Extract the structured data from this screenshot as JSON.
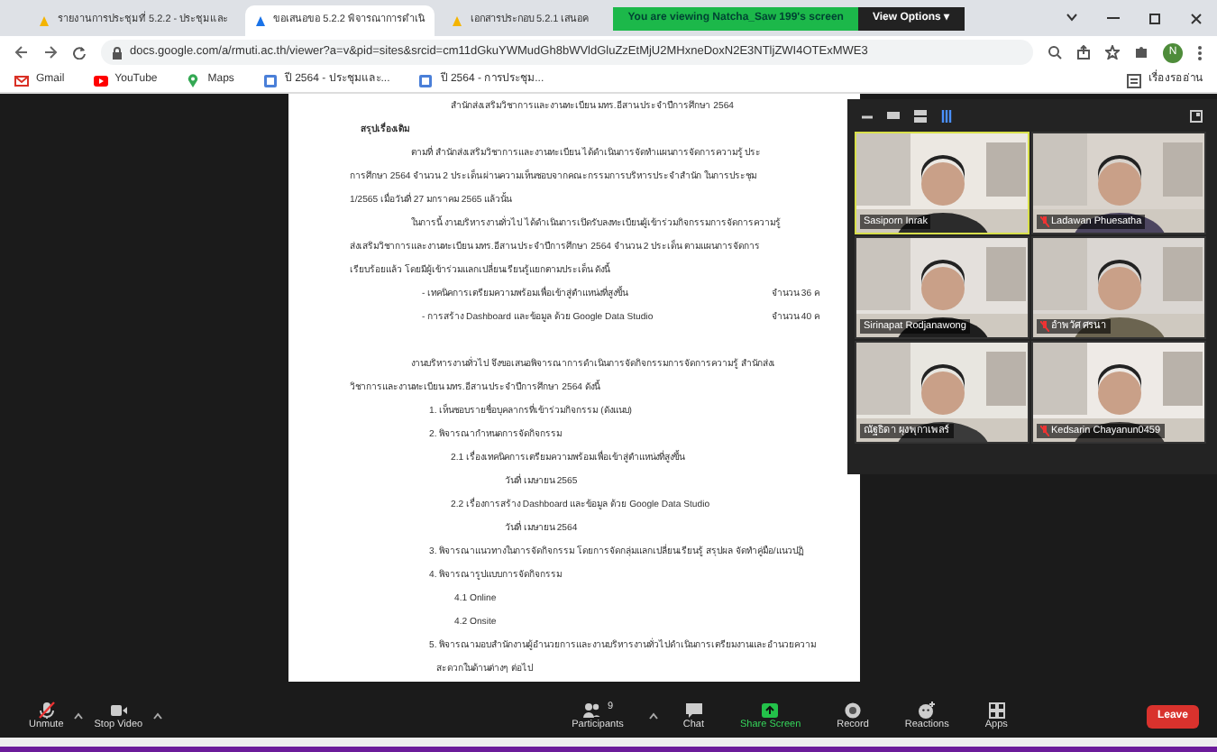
{
  "browser": {
    "tabs": [
      {
        "title": "รายงานการประชุมที่ 5.2.2 - ประชุมและ",
        "selected": false
      },
      {
        "title": "ขอเสนอขอ 5.2.2 พิจารณาการดำเนิ",
        "selected": true
      },
      {
        "title": "เอกสารประกอบ 5.2.1 เสนอค",
        "selected": false
      }
    ],
    "url": "docs.google.com/a/rmuti.ac.th/viewer?a=v&pid=sites&srcid=cm11dGkuYWMudGh8bWVldGluZzEtMjU2MHxneDoxN2E3NTljZWI4OTExMWE3",
    "profile": "N",
    "bookmarks": [
      {
        "label": "Gmail",
        "kind": "mail"
      },
      {
        "label": "YouTube",
        "kind": "play"
      },
      {
        "label": "Maps",
        "kind": "pin"
      },
      {
        "label": "ปี 2564 - ประชุมและ...",
        "kind": "doc"
      },
      {
        "label": "ปี 2564 - การประชุม...",
        "kind": "doc"
      }
    ],
    "reading_list": "เรื่องรออ่าน"
  },
  "share_banner": {
    "text": "You are viewing Natcha_Saw 199's screen",
    "view_options": "View Options ▾"
  },
  "document": {
    "lines": [
      {
        "kind": "center",
        "text": "สำนักส่งเสริมวิชาการและงานทะเบียน มทร.อีสาน ประจำปีการศึกษา 2564"
      },
      {
        "kind": "heading",
        "text": "สรุปเรื่องเดิม"
      },
      {
        "kind": "first",
        "text": "ตามที่   สำนักส่งเสริมวิชาการและงานทะเบียน ได้ดำเนินการจัดทำแผนการจัดการความรู้ ประ"
      },
      {
        "kind": "para",
        "text": "การศึกษา 2564 จำนวน 2 ประเด็น ผ่านความเห็นชอบจากคณะกรรมการบริหารประจำสำนัก ในการประชุม"
      },
      {
        "kind": "para",
        "text": "1/2565 เมื่อวันที่ 27 มกราคม 2565  แล้วนั้น"
      },
      {
        "kind": "first",
        "text": "ในการนี้ งานบริหารงานทั่วไป ได้ดำเนินการเปิดรับลงทะเบียนผู้เข้าร่วมกิจกรรมการจัดการความรู้"
      },
      {
        "kind": "para",
        "text": "ส่งเสริมวิชาการและงานทะเบียน มทร.อีสาน ประจำปีการศึกษา 2564 จำนวน 2 ประเด็น ตามแผนการจัดการ"
      },
      {
        "kind": "para",
        "text": "เรียบร้อยแล้ว  โดยมีผู้เข้าร่วมแลกเปลี่ยนเรียนรู้แยกตามประเด็น  ดังนี้"
      },
      {
        "kind": "bullet",
        "text": "- เทคนิคการเตรียมความพร้อมเพื่อเข้าสู่ตำแหน่งที่สูงขึ้น",
        "amount": "จำนวน  36  ค"
      },
      {
        "kind": "bullet",
        "text": "- การสร้าง Dashboard และข้อมูล ด้วย Google Data Studio",
        "amount": "จำนวน  40  ค"
      },
      {
        "kind": "first",
        "text": "งานบริหารงานทั่วไป  จึงขอเสนอพิจารณาการดำเนินการจัดกิจกรรมการจัดการความรู้ สำนักส่งเ"
      },
      {
        "kind": "para",
        "text": "วิชาการและงานทะเบียน มทร.อีสาน ประจำปีการศึกษา 2564   ดังนี้"
      },
      {
        "kind": "item",
        "text": "1. เห็นชอบรายชื่อบุคลากรที่เข้าร่วมกิจกรรม (ดังแนบ)"
      },
      {
        "kind": "item",
        "text": "2. พิจารณากำหนดการจัดกิจกรรม"
      },
      {
        "kind": "sub",
        "text": "2.1   เรื่องเทคนิคการเตรียมความพร้อมเพื่อเข้าสู่ตำแหน่งที่สูงขึ้น"
      },
      {
        "kind": "date",
        "text": "วันที่     เมษายน  2565"
      },
      {
        "kind": "sub",
        "text": "2.2   เรื่องการสร้าง Dashboard และข้อมูล ด้วย Google Data Studio"
      },
      {
        "kind": "date",
        "text": "วันที่     เมษายน  2564"
      },
      {
        "kind": "item",
        "text": "3. พิจารณาแนวทางในการจัดกิจกรรม  โดยการจัดกลุ่มแลกเปลี่ยนเรียนรู้ สรุปผล จัดทำคู่มือ/แนวปฏิ"
      },
      {
        "kind": "item",
        "text": "4. พิจารณารูปแบบการจัดกิจกรรม"
      },
      {
        "kind": "sub2",
        "text": "4.1  Online"
      },
      {
        "kind": "sub2",
        "text": "4.2  Onsite"
      },
      {
        "kind": "item",
        "text": "5. พิจารณามอบสำนักงานผู้อำนวยการและงานบริหารงานทั่วไปดำเนินการเตรียมงานและอำนวยความ"
      },
      {
        "kind": "cont",
        "text": "สะดวกในด้านต่างๆ ต่อไป"
      }
    ]
  },
  "gallery": {
    "tiles": [
      {
        "name": "Sasiporn Inrak",
        "muted": false,
        "speaking": true,
        "kind": "picture"
      },
      {
        "name": "Ladawan Phuesatha",
        "muted": true,
        "speaking": false,
        "kind": "picture"
      },
      {
        "name": "Sirinapat Rodjanawong",
        "muted": false,
        "speaking": false,
        "kind": "picture"
      },
      {
        "name": "อำพวัศ ศรนา",
        "muted": true,
        "speaking": false,
        "kind": "picture"
      },
      {
        "name": "ณัฐธิดา ผุงพุกาเพลร์",
        "muted": false,
        "speaking": false,
        "kind": "picture"
      },
      {
        "name": "Kedsarin Chayanun0459",
        "muted": true,
        "speaking": false,
        "kind": "picture"
      }
    ]
  },
  "toolbar": {
    "left": [
      {
        "label": "Unmute",
        "kind": "mic"
      },
      {
        "label": "Stop Video",
        "kind": "cam"
      }
    ],
    "center": [
      {
        "label": "Participants",
        "kind": "people",
        "count": "9"
      },
      {
        "label": "Chat",
        "kind": "chat"
      },
      {
        "label": "Share Screen",
        "kind": "share"
      },
      {
        "label": "Record",
        "kind": "record"
      },
      {
        "label": "Reactions",
        "kind": "react"
      },
      {
        "label": "Apps",
        "kind": "apps"
      }
    ],
    "leave": "Leave"
  }
}
